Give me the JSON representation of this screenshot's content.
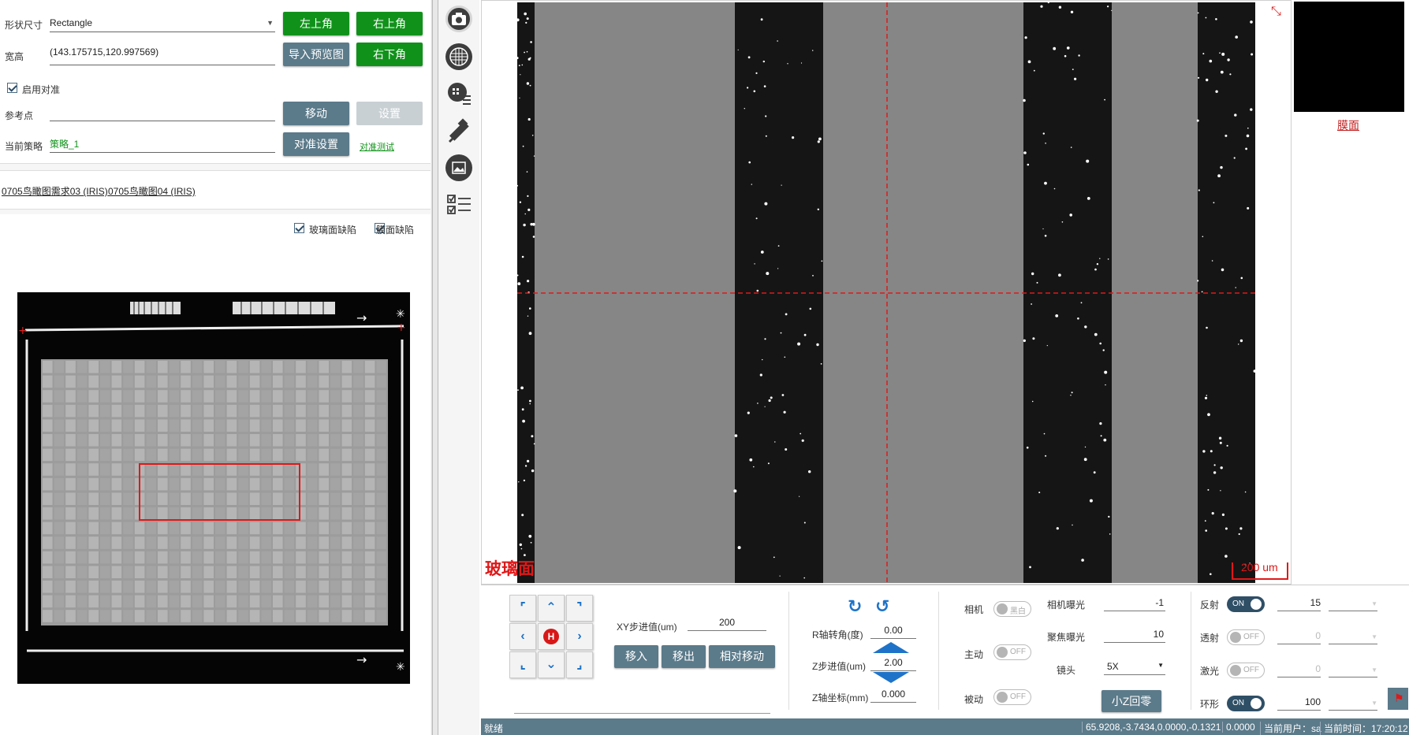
{
  "form": {
    "shape_label": "形状尺寸",
    "shape_value": "Rectangle",
    "size_label": "宽高",
    "size_value": "(143.175715,120.997569)",
    "enable_align_label": "启用对准",
    "ref_point_label": "参考点",
    "ref_point_value": "",
    "strategy_label": "当前策略",
    "strategy_value": "策略_1",
    "buttons": {
      "top_left": "左上角",
      "top_right": "右上角",
      "import_preview": "导入预览图",
      "bottom_right": "右下角",
      "move": "移动",
      "set": "设置",
      "align_settings": "对准设置",
      "align_test": "对准测试"
    }
  },
  "recipes": {
    "items": [
      "0705鸟瞰图需求03 (IRIS)",
      "0705鸟瞰图04 (IRIS)"
    ]
  },
  "map": {
    "glass_defect_label": "玻璃面缺陷",
    "film_defect_label": "膜面缺陷"
  },
  "toolbar": {
    "icons": [
      "camera-icon",
      "grid-icon",
      "wafer-map-icon",
      "measure-icon",
      "image-gallery-icon",
      "checklist-icon"
    ]
  },
  "viewer": {
    "surface_label": "玻璃面",
    "scale_label": "200 um",
    "thumb_label": "膜面"
  },
  "controls": {
    "xy_step_label": "XY步进值(um)",
    "xy_step_value": "200",
    "move_in": "移入",
    "move_out": "移出",
    "relative_move": "相对移动",
    "r_angle_label": "R轴转角(度)",
    "r_angle_value": "0.00",
    "z_step_label": "Z步进值(um)",
    "z_step_value": "2.00",
    "z_coord_label": "Z轴坐标(mm)",
    "z_coord_value": "0.000",
    "camera_label": "相机",
    "camera_toggle": "黑白",
    "active_label": "主动",
    "active_toggle": "OFF",
    "passive_label": "被动",
    "passive_toggle": "OFF",
    "cam_exposure_label": "相机曝光",
    "cam_exposure_value": "-1",
    "focus_exposure_label": "聚焦曝光",
    "focus_exposure_value": "10",
    "lens_label": "镜头",
    "lens_value": "5X",
    "small_z_zero": "小Z回零",
    "reflect_label": "反射",
    "reflect_toggle": "ON",
    "reflect_value": "15",
    "transmit_label": "透射",
    "transmit_toggle": "OFF",
    "transmit_value": "0",
    "laser_label": "激光",
    "laser_toggle": "OFF",
    "laser_value": "0",
    "ring_label": "环形",
    "ring_toggle": "ON",
    "ring_value": "100",
    "home_label": "H"
  },
  "status": {
    "state": "就绪",
    "coords": "65.9208,-3.7434,0.0000,-0.1321",
    "value": "0.0000",
    "user": "当前用户：sa",
    "time": "当前时间：17:20:12"
  },
  "colors": {
    "green": "#10921a",
    "steel": "#5b7a8a",
    "red": "#d81818",
    "blue": "#1e73c8"
  }
}
